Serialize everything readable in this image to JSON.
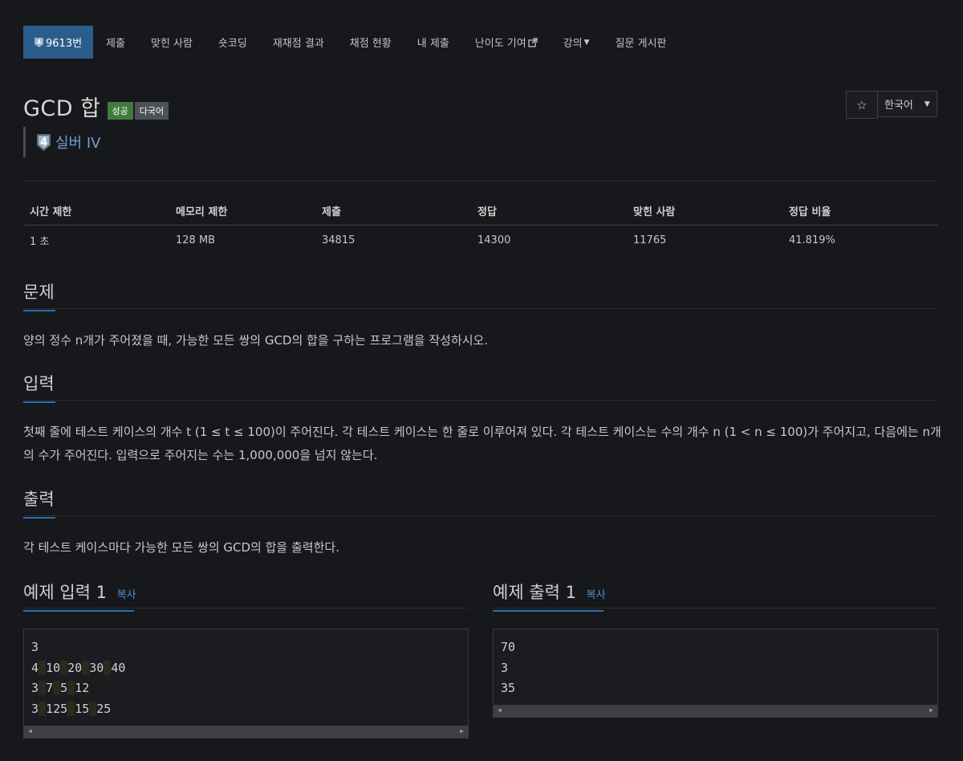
{
  "nav": {
    "items": [
      {
        "label": "9613번",
        "active": true,
        "icon": "tier-silver-4-icon"
      },
      {
        "label": "제출"
      },
      {
        "label": "맞힌 사람"
      },
      {
        "label": "숏코딩"
      },
      {
        "label": "재채점 결과"
      },
      {
        "label": "채점 현황"
      },
      {
        "label": "내 제출"
      },
      {
        "label": "난이도 기여",
        "icon": "external-link-icon"
      },
      {
        "label": "강의",
        "icon": "caret-down-icon"
      },
      {
        "label": "질문 게시판"
      }
    ]
  },
  "problem": {
    "title": "GCD 합",
    "labels": [
      "성공",
      "다국어"
    ],
    "tier": "실버 IV",
    "tier_number": "4"
  },
  "tools": {
    "star": "☆",
    "language": "한국어"
  },
  "stats": {
    "headers": [
      "시간 제한",
      "메모리 제한",
      "제출",
      "정답",
      "맞힌 사람",
      "정답 비율"
    ],
    "values": [
      "1 초",
      "128 MB",
      "34815",
      "14300",
      "11765",
      "41.819%"
    ]
  },
  "sections": {
    "problem": {
      "heading": "문제",
      "text": "양의 정수 n개가 주어졌을 때, 가능한 모든 쌍의 GCD의 합을 구하는 프로그램을 작성하시오."
    },
    "input": {
      "heading": "입력",
      "text": "첫째 줄에 테스트 케이스의 개수 t (1 ≤ t ≤ 100)이 주어진다. 각 테스트 케이스는 한 줄로 이루어져 있다. 각 테스트 케이스는 수의 개수 n (1 < n ≤ 100)가 주어지고, 다음에는 n개의 수가 주어진다. 입력으로 주어지는 수는 1,000,000을 넘지 않는다."
    },
    "output": {
      "heading": "출력",
      "text": "각 테스트 케이스마다 가능한 모든 쌍의 GCD의 합을 출력한다."
    }
  },
  "samples": {
    "input": {
      "heading": "예제 입력 1",
      "copy": "복사",
      "lines": [
        "3",
        "4 10 20 30 40",
        "3 7 5 12",
        "3 125 15 25"
      ]
    },
    "output": {
      "heading": "예제 출력 1",
      "copy": "복사",
      "lines": [
        "70",
        "3",
        "35"
      ]
    }
  },
  "colors": {
    "accent": "#2a5d8c",
    "link": "#4c8fd6",
    "success": "#3f7b3f",
    "background": "#17181b"
  }
}
